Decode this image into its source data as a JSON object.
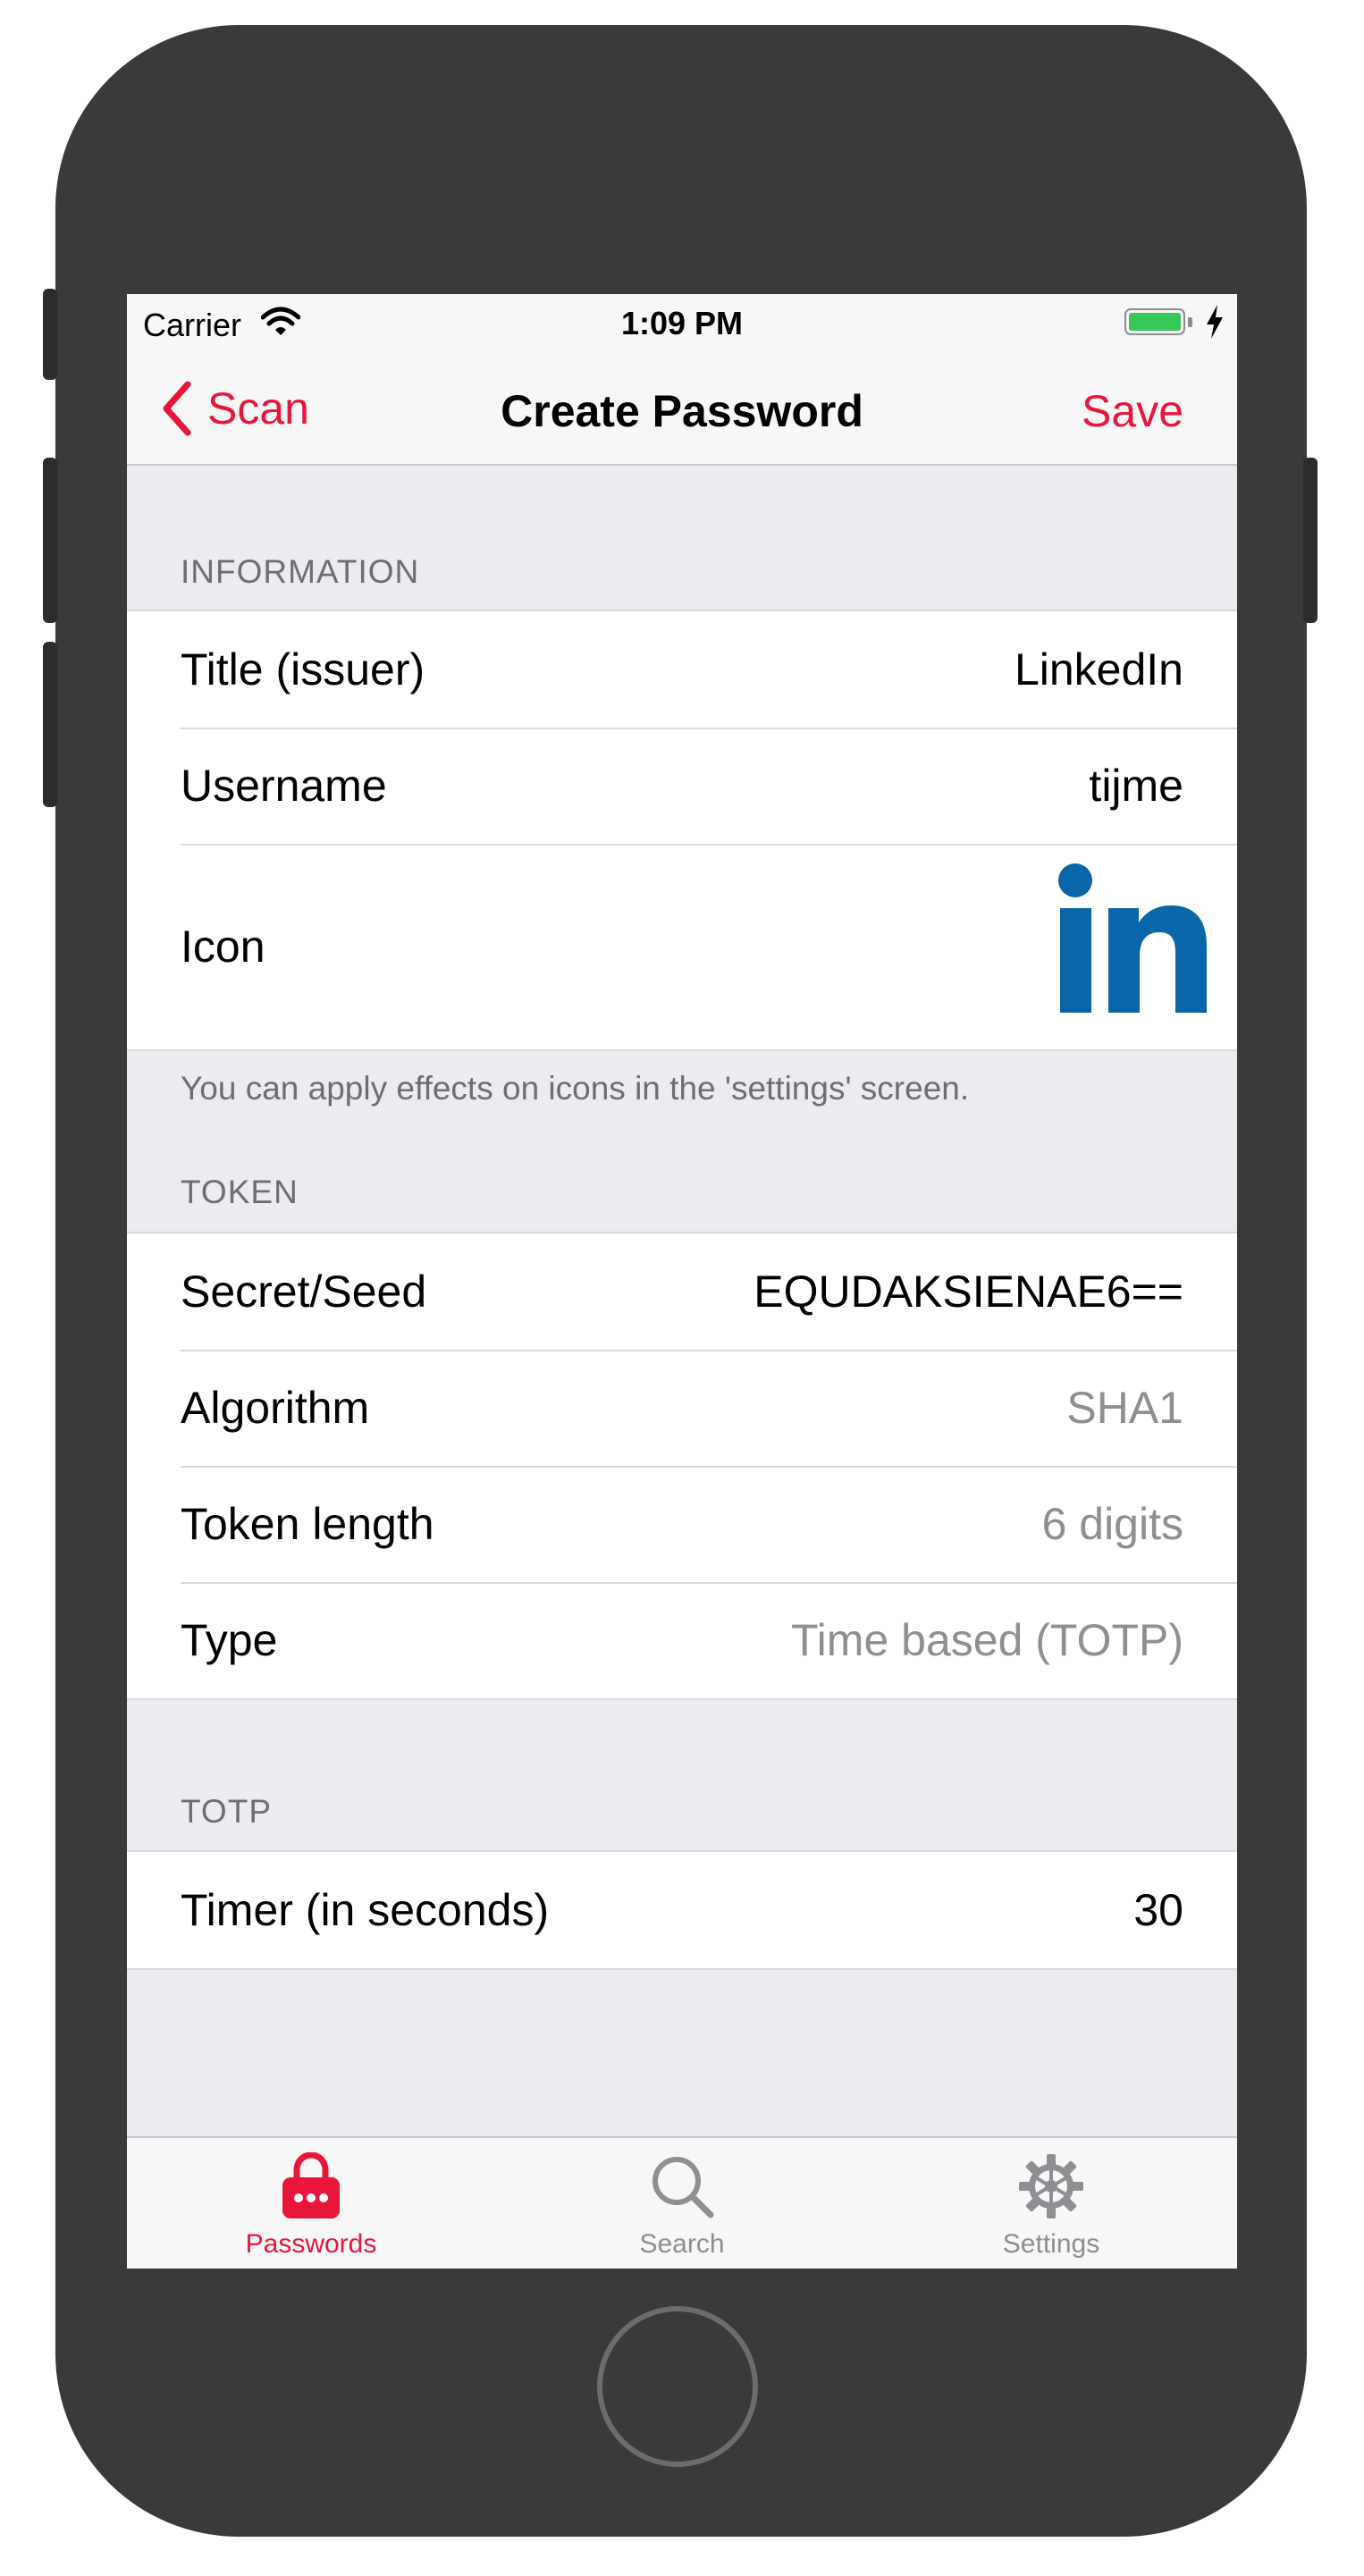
{
  "status_bar": {
    "carrier": "Carrier",
    "time": "1:09 PM"
  },
  "nav": {
    "back_label": "Scan",
    "title": "Create Password",
    "save_label": "Save"
  },
  "information": {
    "header": "INFORMATION",
    "rows": [
      {
        "label": "Title (issuer)",
        "value": "LinkedIn"
      },
      {
        "label": "Username",
        "value": "tijme"
      },
      {
        "label": "Icon",
        "value": "in"
      }
    ],
    "footer": "You can apply effects on icons in the 'settings' screen."
  },
  "token": {
    "header": "TOKEN",
    "rows": [
      {
        "label": "Secret/Seed",
        "value": "EQUDAKSIENAE6=="
      },
      {
        "label": "Algorithm",
        "value": "SHA1"
      },
      {
        "label": "Token length",
        "value": "6 digits"
      },
      {
        "label": "Type",
        "value": "Time based (TOTP)"
      }
    ]
  },
  "totp": {
    "header": "TOTP",
    "rows": [
      {
        "label": "Timer (in seconds)",
        "value": "30"
      }
    ]
  },
  "tabbar": {
    "tabs": [
      {
        "label": "Passwords",
        "icon": "lock-icon",
        "active": true
      },
      {
        "label": "Search",
        "icon": "search-icon",
        "active": false
      },
      {
        "label": "Settings",
        "icon": "gear-icon",
        "active": false
      }
    ]
  },
  "colors": {
    "accent": "#e8163a",
    "linkedin": "#0a66a8",
    "background": "#ebebf0",
    "secondary_text": "#8e8e93"
  }
}
